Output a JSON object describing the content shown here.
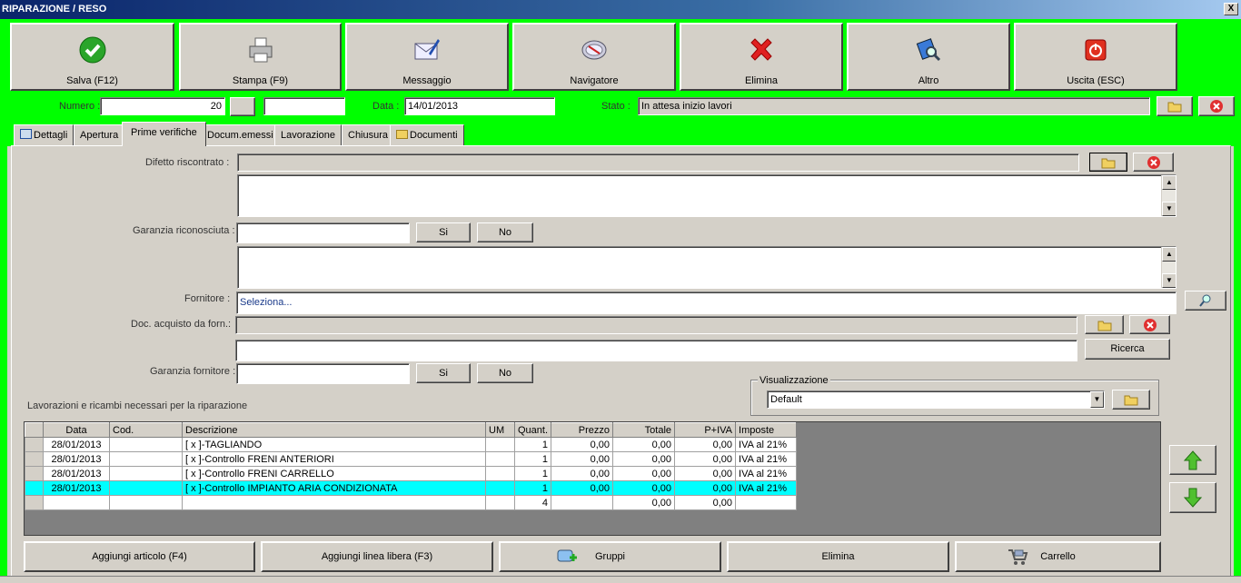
{
  "window": {
    "title": "RIPARAZIONE / RESO",
    "close": "X"
  },
  "toolbar": [
    {
      "label": "Salva (F12)",
      "icon": "check-icon"
    },
    {
      "label": "Stampa (F9)",
      "icon": "printer-icon"
    },
    {
      "label": "Messaggio",
      "icon": "envelope-icon"
    },
    {
      "label": "Navigatore",
      "icon": "compass-icon"
    },
    {
      "label": "Elimina",
      "icon": "red-x-icon"
    },
    {
      "label": "Altro",
      "icon": "search-book-icon"
    },
    {
      "label": "Uscita (ESC)",
      "icon": "power-icon"
    }
  ],
  "header": {
    "numero_label": "Numero :",
    "numero_value": "20",
    "data_label": "Data :",
    "data_value": "14/01/2013",
    "stato_label": "Stato :",
    "stato_value": "In attesa inizio lavori"
  },
  "tabs": [
    "Dettagli",
    "Apertura",
    "Prime verifiche",
    "Docum.emessi",
    "Lavorazione",
    "Chiusura",
    "Documenti"
  ],
  "form": {
    "difetto_label": "Difetto riscontrato :",
    "garanzia_label": "Garanzia riconosciuta :",
    "si_label": "Si",
    "no_label": "No",
    "fornitore_label": "Fornitore :",
    "fornitore_value": "Seleziona...",
    "doc_label": "Doc. acquisto da forn.:",
    "ricerca_label": "Ricerca",
    "garanzia_forn_label": "Garanzia fornitore :",
    "visualizzazione_label": "Visualizzazione",
    "visualizzazione_value": "Default",
    "lavorazioni_label": "Lavorazioni e ricambi necessari per la riparazione"
  },
  "grid": {
    "columns": [
      "Data",
      "Cod.",
      "Descrizione",
      "UM",
      "Quant.",
      "Prezzo",
      "Totale",
      "P+IVA",
      "Imposte"
    ],
    "rows": [
      [
        "28/01/2013",
        "",
        "[ x ]-TAGLIANDO",
        "",
        "1",
        "0,00",
        "0,00",
        "0,00",
        "IVA al 21%"
      ],
      [
        "28/01/2013",
        "",
        "[ x ]-Controllo FRENI ANTERIORI",
        "",
        "1",
        "0,00",
        "0,00",
        "0,00",
        "IVA al 21%"
      ],
      [
        "28/01/2013",
        "",
        "[ x ]-Controllo FRENI CARRELLO",
        "",
        "1",
        "0,00",
        "0,00",
        "0,00",
        "IVA al 21%"
      ],
      [
        "28/01/2013",
        "",
        "[ x ]-Controllo IMPIANTO ARIA CONDIZIONATA",
        "",
        "1",
        "0,00",
        "0,00",
        "0,00",
        "IVA al 21%"
      ]
    ],
    "totals": [
      "",
      "",
      "",
      "",
      "4",
      "",
      "0,00",
      "0,00",
      ""
    ]
  },
  "bottom": {
    "aggiungi_articolo": "Aggiungi articolo (F4)",
    "aggiungi_linea": "Aggiungi linea libera (F3)",
    "gruppi": "Gruppi",
    "elimina": "Elimina",
    "carrello": "Carrello"
  }
}
